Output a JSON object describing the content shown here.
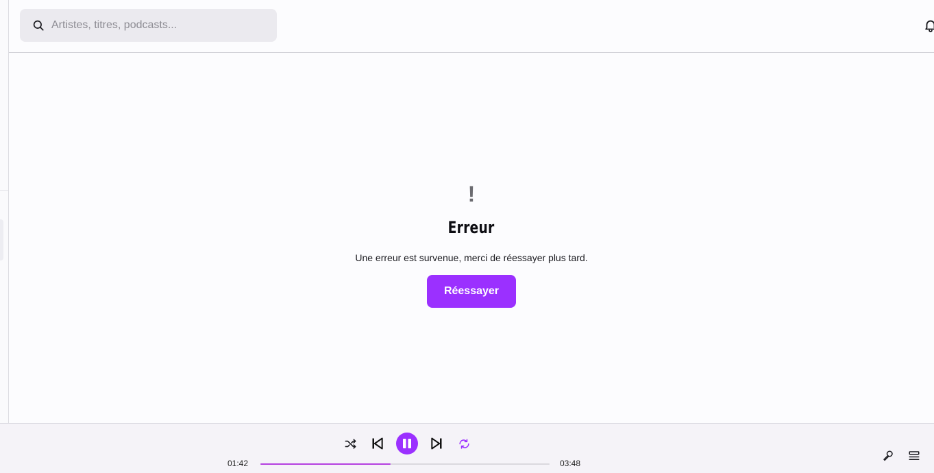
{
  "search": {
    "placeholder": "Artistes, titres, podcasts..."
  },
  "error": {
    "mark": "!",
    "title": "Erreur",
    "message": "Une erreur est survenue, merci de réessayer plus tard.",
    "retry_label": "Réessayer"
  },
  "player": {
    "current_time": "01:42",
    "duration": "03:48",
    "progress": 0.45,
    "is_playing": true,
    "repeat_active": true
  },
  "theme": {
    "accent": "#9b30ff",
    "progress_fill": "#b43fe0"
  },
  "icons": {
    "search": "search-icon",
    "notifications": "bell-icon",
    "shuffle": "shuffle-icon",
    "previous": "skip-previous-icon",
    "pause": "pause-icon",
    "next": "skip-next-icon",
    "repeat": "repeat-icon",
    "lyrics": "microphone-icon",
    "queue": "queue-icon"
  }
}
